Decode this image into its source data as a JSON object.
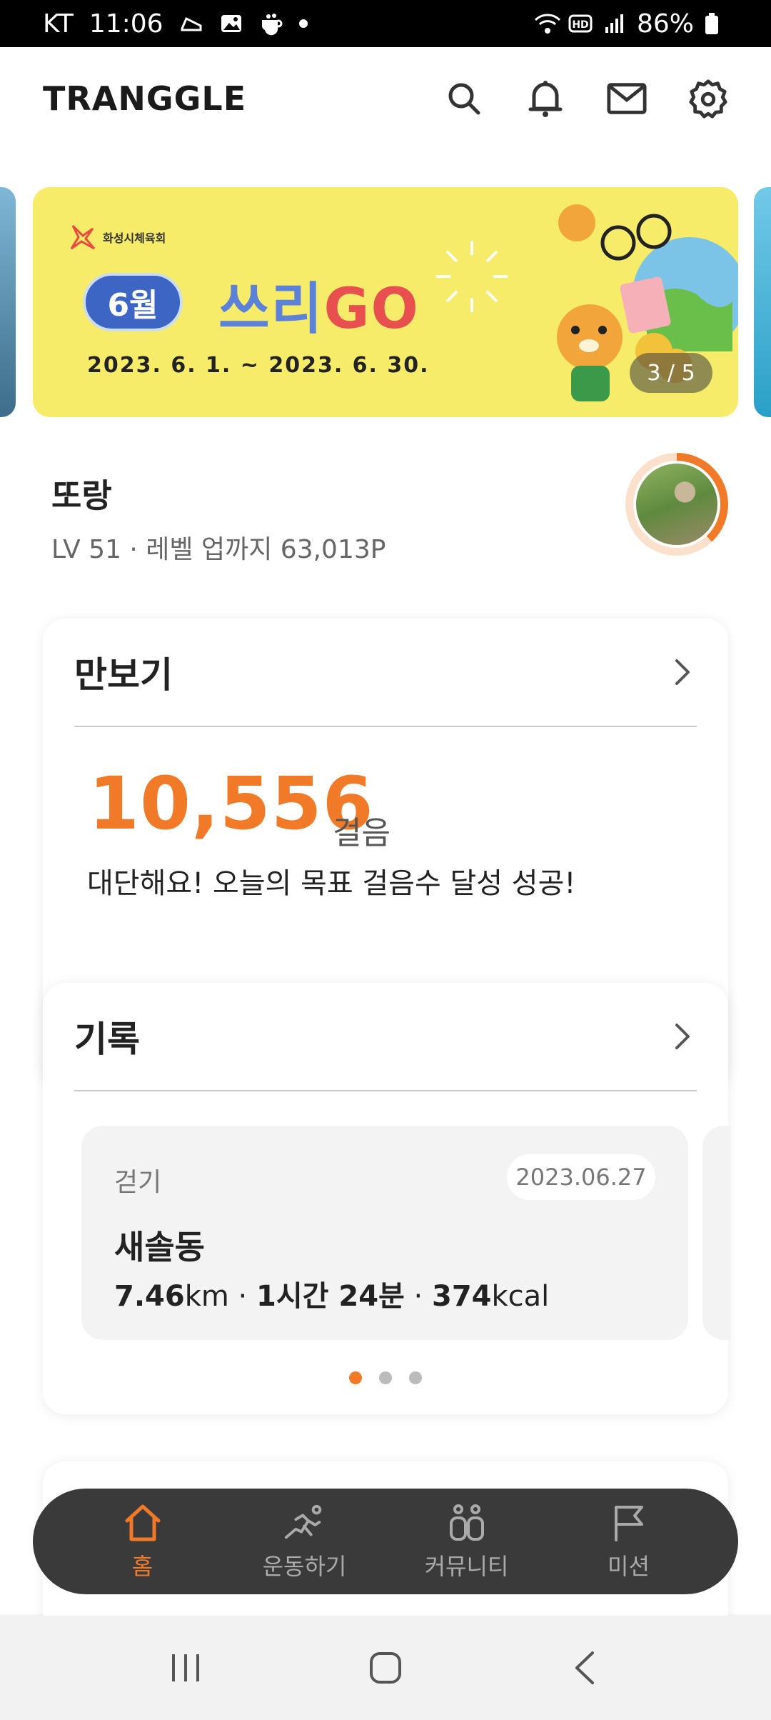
{
  "status_bar": {
    "carrier": "KT",
    "time": "11:06",
    "battery": "86%"
  },
  "header": {
    "logo": "TRANGGLE",
    "icons": [
      "search-icon",
      "bell-icon",
      "mail-icon",
      "gear-icon"
    ]
  },
  "banner": {
    "org": "화성시체육회",
    "month": "6월",
    "campaign_main": "쓰리",
    "campaign_go": "GO",
    "period": "2023. 6. 1. ~ 2023. 6. 30.",
    "counter": "3 / 5"
  },
  "profile": {
    "name": "또랑",
    "level": "LV 51 · 레벨 업까지 63,013P",
    "level_progress": 0.38
  },
  "pedometer": {
    "title": "만보기",
    "steps": "10,556",
    "unit": "걸음",
    "message": "대단해요! 오늘의 목표 걸음수 달성 성공!"
  },
  "records": {
    "title": "기록",
    "item": {
      "type": "걷기",
      "date": "2023.06.27",
      "place": "새솔동",
      "distance": "7.46",
      "distance_unit": "km",
      "duration": "1시간 24분",
      "calories": "374",
      "calories_unit": "kcal"
    },
    "pages": 3,
    "active_page": 1
  },
  "bottom_nav": {
    "items": [
      {
        "label": "홈",
        "icon": "home-icon",
        "active": true
      },
      {
        "label": "운동하기",
        "icon": "running-icon",
        "active": false
      },
      {
        "label": "커뮤니티",
        "icon": "community-icon",
        "active": false
      },
      {
        "label": "미션",
        "icon": "flag-icon",
        "active": false
      }
    ]
  },
  "colors": {
    "accent": "#f07a28",
    "nav_bg": "#3a3a3a"
  }
}
